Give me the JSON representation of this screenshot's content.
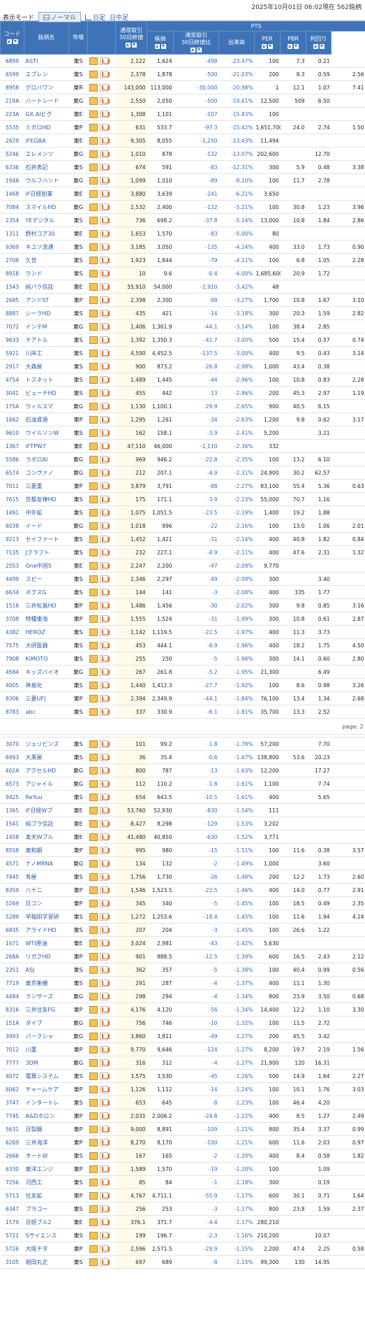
{
  "header": {
    "timestamp": "2025年10月01日 06:02現在 562銘柄",
    "mode_label": "表示モード",
    "mode_normal": "ノーマル",
    "mode_daily": "日足",
    "mode_intraday": "日中足"
  },
  "columns": {
    "code": "コード",
    "name": "銘柄名",
    "market": "市場",
    "vol30": "通常取引\n30日終値",
    "pts": "PTS",
    "price": "株価",
    "change": "通常取引\n30日終値比",
    "volume": "出来高",
    "per": "PER",
    "pbr": "PBR",
    "yield": "利回り"
  },
  "page_label": "page: 2",
  "rows": [
    [
      "6899",
      "ASTI",
      "東S",
      "2,122",
      "1,624",
      "-498",
      "-23.47%",
      "100",
      "7.3",
      "0.21",
      ""
    ],
    [
      "6599",
      "エブレン",
      "東S",
      "2,378",
      "1,878",
      "-500",
      "-21.03%",
      "200",
      "8.3",
      "0.59",
      "2.56"
    ],
    [
      "8958",
      "グロバワン",
      "東R",
      "143,000",
      "113,000",
      "-30,000",
      "-20.98%",
      "1",
      "12.1",
      "1.07",
      "7.41"
    ],
    [
      "219A",
      "ハートシード",
      "東G",
      "2,550",
      "2,050",
      "-500",
      "-19.61%",
      "12,500",
      "509",
      "6.50",
      ""
    ],
    [
      "223A",
      "GX AIビグ",
      "東E",
      "1,308",
      "1,101",
      "-207",
      "-15.83%",
      "100",
      "",
      "",
      ""
    ],
    [
      "5535",
      "ミガロHD",
      "東P",
      "631",
      "533.7",
      "-97.3",
      "-15.42%",
      "1,651,700",
      "24.0",
      "2.74",
      "1.50"
    ],
    [
      "2629",
      "iFEGBA",
      "東E",
      "9,305",
      "8,055",
      "-1,250",
      "-13.43%",
      "11,494",
      "",
      "",
      ""
    ],
    [
      "5246",
      "エレメンツ",
      "東G",
      "1,010",
      "878",
      "-132",
      "-13.07%",
      "202,600",
      "",
      "12.70",
      ""
    ],
    [
      "6336",
      "石井表記",
      "東S",
      "674",
      "591",
      "-83",
      "-12.31%",
      "300",
      "5.9",
      "0.48",
      "3.38"
    ],
    [
      "194A",
      "ウルフハンド",
      "東G",
      "1,099",
      "1,010",
      "-89",
      "-8.10%",
      "100",
      "11.7",
      "2.78",
      ""
    ],
    [
      "1468",
      "iF日経創業",
      "東E",
      "3,880",
      "3,639",
      "-241",
      "-6.21%",
      "3,650",
      "",
      "",
      ""
    ],
    [
      "7084",
      "スマイルHD",
      "東G",
      "2,532",
      "2,400",
      "-132",
      "-5.21%",
      "100",
      "30.8",
      "1.23",
      "3.96"
    ],
    [
      "2354",
      "YEデジタル",
      "東S",
      "736",
      "698.2",
      "-37.8",
      "-5.14%",
      "13,000",
      "10.8",
      "1.84",
      "2.86"
    ],
    [
      "1311",
      "野村コア30",
      "東E",
      "1,653",
      "1,570",
      "-83",
      "-5.00%",
      "80",
      "",
      "",
      ""
    ],
    [
      "9369",
      "キユソ流通",
      "東S",
      "3,185",
      "3,050",
      "-135",
      "-4.24%",
      "400",
      "33.0",
      "1.73",
      "0.90"
    ],
    [
      "2708",
      "久世",
      "東S",
      "1,923",
      "1,844",
      "-79",
      "-4.11%",
      "100",
      "6.8",
      "1.05",
      "2.28"
    ],
    [
      "8918",
      "ランド",
      "東S",
      "10",
      "9.6",
      "-0.4",
      "-4.00%",
      "1,685,600",
      "20.9",
      "1.72",
      ""
    ],
    [
      "1543",
      "純パラ信託",
      "東E",
      "55,910",
      "54,000",
      "-1,910",
      "-3.42%",
      "48",
      "",
      "",
      ""
    ],
    [
      "2685",
      "アンドST",
      "東P",
      "2,398",
      "2,300",
      "-98",
      "-3.27%",
      "1,700",
      "10.8",
      "1.67",
      "3.10"
    ],
    [
      "8887",
      "シーラHD",
      "東S",
      "435",
      "421",
      "-14",
      "-3.18%",
      "300",
      "20.3",
      "1.59",
      "2.82"
    ],
    [
      "7072",
      "インテM",
      "東G",
      "1,406",
      "1,361.9",
      "-44.1",
      "-3.14%",
      "100",
      "38.4",
      "2.85",
      ""
    ],
    [
      "9633",
      "テアトル",
      "東S",
      "1,392",
      "1,350.3",
      "-41.7",
      "-3.00%",
      "500",
      "15.4",
      "0.57",
      "0.74"
    ],
    [
      "5921",
      "川岸工",
      "東S",
      "4,590",
      "4,452.5",
      "-137.5",
      "-3.00%",
      "400",
      "9.5",
      "0.43",
      "3.14"
    ],
    [
      "2917",
      "大森屋",
      "東S",
      "900",
      "873.2",
      "-26.8",
      "-2.98%",
      "1,000",
      "43.4",
      "0.38",
      ""
    ],
    [
      "4754",
      "トスネット",
      "東S",
      "1,489",
      "1,445",
      "-44",
      "-2.96%",
      "100",
      "10.8",
      "0.83",
      "2.28"
    ],
    [
      "3041",
      "ビューテHD",
      "東S",
      "455",
      "442",
      "-13",
      "-2.86%",
      "200",
      "45.3",
      "2.97",
      "1.19"
    ],
    [
      "175A",
      "ウィルスマ",
      "東G",
      "1,130",
      "1,100.1",
      "-29.9",
      "-2.65%",
      "900",
      "40.5",
      "6.15",
      ""
    ],
    [
      "1662",
      "石油資源",
      "東P",
      "1,295",
      "1,261",
      "-34",
      "-2.63%",
      "1,200",
      "9.8",
      "0.62",
      "3.17"
    ],
    [
      "9610",
      "ウイルソンW",
      "東S",
      "162",
      "158.1",
      "-3.9",
      "-2.41%",
      "5,200",
      "",
      "3.21",
      ""
    ],
    [
      "1367",
      "iFTPW7",
      "東E",
      "47,110",
      "46,000",
      "-1,110",
      "-2.36%",
      "332",
      "",
      "",
      ""
    ],
    [
      "5586",
      "ラボロAI",
      "東G",
      "969",
      "946.2",
      "-22.8",
      "-2.35%",
      "100",
      "13.2",
      "6.10",
      ""
    ],
    [
      "6574",
      "コンヴァノ",
      "東G",
      "212",
      "207.1",
      "-4.9",
      "-2.31%",
      "24,900",
      "30.2",
      "62.57",
      ""
    ],
    [
      "7011",
      "三菱重",
      "東P",
      "3,879",
      "3,791",
      "-88",
      "-2.27%",
      "83,100",
      "55.4",
      "5.36",
      "0.63"
    ],
    [
      "7615",
      "京都友禅HD",
      "東S",
      "175",
      "171.1",
      "-3.9",
      "-2.23%",
      "55,000",
      "70.7",
      "1.16",
      ""
    ],
    [
      "1491",
      "中外鉱",
      "東S",
      "1,075",
      "1,051.5",
      "-23.5",
      "-2.19%",
      "1,400",
      "19.2",
      "1.88",
      ""
    ],
    [
      "6038",
      "イード",
      "東G",
      "1,018",
      "996",
      "-22",
      "-2.16%",
      "100",
      "13.0",
      "1.06",
      "2.01"
    ],
    [
      "9213",
      "セイファート",
      "東S",
      "1,452",
      "1,421",
      "-31",
      "-2.14%",
      "400",
      "40.8",
      "1.82",
      "0.84"
    ],
    [
      "7135",
      "Jクラフト",
      "東S",
      "232",
      "227.1",
      "-4.9",
      "-2.11%",
      "400",
      "47.6",
      "2.31",
      "1.32"
    ],
    [
      "2553",
      "One中国5",
      "東E",
      "2,247",
      "2,200",
      "-47",
      "-2.09%",
      "9,770",
      "",
      "",
      ""
    ],
    [
      "4499",
      "スピー",
      "東S",
      "2,346",
      "2,297",
      "-49",
      "-2.09%",
      "300",
      "",
      "3.40",
      ""
    ],
    [
      "6634",
      "ネクスG",
      "東S",
      "144",
      "141",
      "-3",
      "-2.08%",
      "400",
      "335",
      "1.77",
      ""
    ],
    [
      "1518",
      "三井松島HD",
      "東P",
      "1,486",
      "1,456",
      "-30",
      "-2.02%",
      "300",
      "9.8",
      "0.85",
      "3.16"
    ],
    [
      "3708",
      "特種東海",
      "東P",
      "1,555",
      "1,524",
      "-31",
      "-1.99%",
      "300",
      "10.8",
      "0.61",
      "2.87"
    ],
    [
      "4382",
      "HEROZ",
      "東S",
      "1,142",
      "1,119.5",
      "-22.5",
      "-1.97%",
      "400",
      "11.3",
      "3.73",
      ""
    ],
    [
      "7575",
      "大研医器",
      "東S",
      "453",
      "444.1",
      "-8.9",
      "-1.96%",
      "400",
      "18.2",
      "1.75",
      "4.50"
    ],
    [
      "7908",
      "KIMOTO",
      "東S",
      "255",
      "250",
      "-5",
      "-1.96%",
      "300",
      "14.1",
      "0.60",
      "2.80"
    ],
    [
      "4584",
      "キッズバイオ",
      "東G",
      "267",
      "261.8",
      "-5.2",
      "-1.95%",
      "21,300",
      "",
      "6.49",
      ""
    ],
    [
      "4005",
      "神島化",
      "東S",
      "1,440",
      "1,412.3",
      "-27.7",
      "-1.92%",
      "100",
      "8.6",
      "0.98",
      "3.26"
    ],
    [
      "8306",
      "三菱UFJ",
      "東P",
      "2,394",
      "2,349.9",
      "-44.1",
      "-1.84%",
      "76,100",
      "13.4",
      "1.34",
      "2.68"
    ],
    [
      "8783",
      "abc",
      "東S",
      "337",
      "330.9",
      "-6.1",
      "-1.81%",
      "35,700",
      "13.3",
      "2.52",
      ""
    ]
  ],
  "rows2": [
    [
      "3070",
      "ジェリビンズ",
      "東S",
      "101",
      "99.2",
      "-1.8",
      "-1.78%",
      "57,200",
      "",
      "7.70",
      ""
    ],
    [
      "6993",
      "大黒屋",
      "東S",
      "36",
      "35.4",
      "-0.6",
      "-1.67%",
      "138,800",
      "53.6",
      "20.23",
      ""
    ],
    [
      "402A",
      "アクセルHD",
      "東G",
      "800",
      "787",
      "-13",
      "-1.63%",
      "12,200",
      "",
      "17.27",
      ""
    ],
    [
      "6573",
      "アジャイル",
      "東G",
      "112",
      "110.2",
      "-1.8",
      "-1.61%",
      "1,100",
      "",
      "7.74",
      ""
    ],
    [
      "9425",
      "ReYuu",
      "東S",
      "654",
      "643.5",
      "-10.5",
      "-1.61%",
      "400",
      "",
      "5.65",
      ""
    ],
    [
      "1365",
      "iF日経Wブ",
      "東E",
      "53,760",
      "52,930",
      "-830",
      "-1.54%",
      "111",
      "",
      "",
      ""
    ],
    [
      "1541",
      "純プラ信託",
      "東E",
      "8,427",
      "8,298",
      "-129",
      "-1.53%",
      "3,202",
      "",
      "",
      ""
    ],
    [
      "1458",
      "楽天Wブル",
      "東E",
      "41,480",
      "40,850",
      "-630",
      "-1.52%",
      "3,771",
      "",
      "",
      ""
    ],
    [
      "8558",
      "東和銀",
      "東P",
      "995",
      "980",
      "-15",
      "-1.51%",
      "100",
      "11.6",
      "0.38",
      "3.57"
    ],
    [
      "4571",
      "ナノMRNA",
      "東G",
      "134",
      "132",
      "-2",
      "-1.49%",
      "1,000",
      "",
      "3.60",
      ""
    ],
    [
      "7445",
      "寿屋",
      "東S",
      "1,756",
      "1,730",
      "-26",
      "-1.48%",
      "200",
      "12.2",
      "1.73",
      "2.60"
    ],
    [
      "8359",
      "八十二",
      "東P",
      "1,546",
      "1,523.5",
      "-22.5",
      "-1.46%",
      "400",
      "14.0",
      "0.77",
      "2.91"
    ],
    [
      "5269",
      "日コン",
      "東P",
      "345",
      "340",
      "-5",
      "-1.45%",
      "100",
      "18.5",
      "0.49",
      "2.35"
    ],
    [
      "5289",
      "早稲田学習研",
      "東S",
      "1,272",
      "1,253.6",
      "-18.4",
      "-1.45%",
      "100",
      "11.6",
      "1.94",
      "4.24"
    ],
    [
      "6835",
      "アライドHD",
      "東S",
      "207",
      "204",
      "-3",
      "-1.45%",
      "100",
      "26.6",
      "1.22",
      ""
    ],
    [
      "1671",
      "WTI原油",
      "東E",
      "3,024",
      "2,981",
      "-43",
      "-1.42%",
      "5,630",
      "",
      "",
      ""
    ],
    [
      "268A",
      "リガクHD",
      "東P",
      "901",
      "888.5",
      "-12.5",
      "-1.39%",
      "600",
      "16.5",
      "2.43",
      "2.12"
    ],
    [
      "2351",
      "ASJ",
      "東S",
      "362",
      "357",
      "-5",
      "-1.38%",
      "100",
      "40.4",
      "0.99",
      "0.56"
    ],
    [
      "7719",
      "東京衡機",
      "東S",
      "291",
      "287",
      "-4",
      "-1.37%",
      "400",
      "11.1",
      "1.30",
      ""
    ],
    [
      "4484",
      "ランサーズ",
      "東G",
      "298",
      "294",
      "-4",
      "-1.34%",
      "800",
      "23.9",
      "3.50",
      "0.68"
    ],
    [
      "8316",
      "三井住友FG",
      "東P",
      "4,176",
      "4,120",
      "-56",
      "-1.34%",
      "14,400",
      "12.2",
      "1.10",
      "3.30"
    ],
    [
      "151A",
      "ダイブ",
      "東G",
      "756",
      "746",
      "-10",
      "-1.32%",
      "100",
      "11.5",
      "2.72",
      ""
    ],
    [
      "3993",
      "パークシャ",
      "東G",
      "3,860",
      "3,811",
      "-49",
      "-1.27%",
      "200",
      "45.5",
      "3.42",
      ""
    ],
    [
      "7012",
      "川重",
      "東P",
      "9,770",
      "9,646",
      "-124",
      "-1.27%",
      "8,200",
      "19.7",
      "2.19",
      "1.56"
    ],
    [
      "7777",
      "3DM",
      "東G",
      "316",
      "312",
      "-4",
      "-1.27%",
      "21,900",
      "120",
      "16.31",
      ""
    ],
    [
      "4072",
      "電算システム",
      "東S",
      "3,575",
      "3,530",
      "-45",
      "-1.26%",
      "500",
      "14.9",
      "1.64",
      "2.27"
    ],
    [
      "6062",
      "チャームケア",
      "東P",
      "1,126",
      "1,112",
      "-14",
      "-1.24%",
      "100",
      "10.1",
      "1.76",
      "3.03"
    ],
    [
      "3747",
      "インタートレ",
      "東S",
      "653",
      "645",
      "-8",
      "-1.23%",
      "100",
      "46.4",
      "4.20",
      ""
    ],
    [
      "7745",
      "A&Dホロン",
      "東P",
      "2,031",
      "2,006.2",
      "-24.8",
      "-1.22%",
      "400",
      "8.5",
      "1.27",
      "2.49"
    ],
    [
      "5631",
      "日製鋼",
      "東P",
      "9,000",
      "8,891",
      "-109",
      "-1.21%",
      "800",
      "35.4",
      "3.37",
      "0.99"
    ],
    [
      "6269",
      "三井海洋",
      "東P",
      "8,270",
      "8,170",
      "-100",
      "-1.21%",
      "600",
      "11.6",
      "2.03",
      "0.97"
    ],
    [
      "2666",
      "オートW",
      "東S",
      "167",
      "165",
      "-2",
      "-1.20%",
      "400",
      "8.4",
      "0.58",
      "1.82"
    ],
    [
      "6330",
      "東洋エンジ",
      "東P",
      "1,589",
      "1,570",
      "-19",
      "-1.20%",
      "100",
      "",
      "1.09",
      ""
    ],
    [
      "7256",
      "河西工",
      "東S",
      "85",
      "84",
      "-1",
      "-1.18%",
      "300",
      "",
      "0.19",
      ""
    ],
    [
      "5713",
      "住友鉱",
      "東P",
      "4,767",
      "4,711.1",
      "-55.9",
      "-1.17%",
      "600",
      "30.1",
      "0.71",
      "1.64"
    ],
    [
      "6347",
      "プラコー",
      "東S",
      "256",
      "253",
      "-3",
      "-1.17%",
      "800",
      "23.8",
      "1.59",
      "2.37"
    ],
    [
      "1579",
      "日経ブル2",
      "東E",
      "376.1",
      "371.7",
      "-4.4",
      "-1.17%",
      "280,210",
      "",
      "",
      ""
    ],
    [
      "5721",
      "Sサイエンス",
      "東S",
      "199",
      "196.7",
      "-2.3",
      "-1.16%",
      "210,200",
      "",
      "10.07",
      ""
    ],
    [
      "5726",
      "大阪チタ",
      "東P",
      "2,596",
      "2,571.5",
      "-29.9",
      "-1.15%",
      "2,200",
      "47.4",
      "2.25",
      "0.58"
    ],
    [
      "3105",
      "堀田丸正",
      "東S",
      "697",
      "689",
      "-8",
      "-1.15%",
      "99,300",
      "130",
      "14.95",
      ""
    ]
  ]
}
